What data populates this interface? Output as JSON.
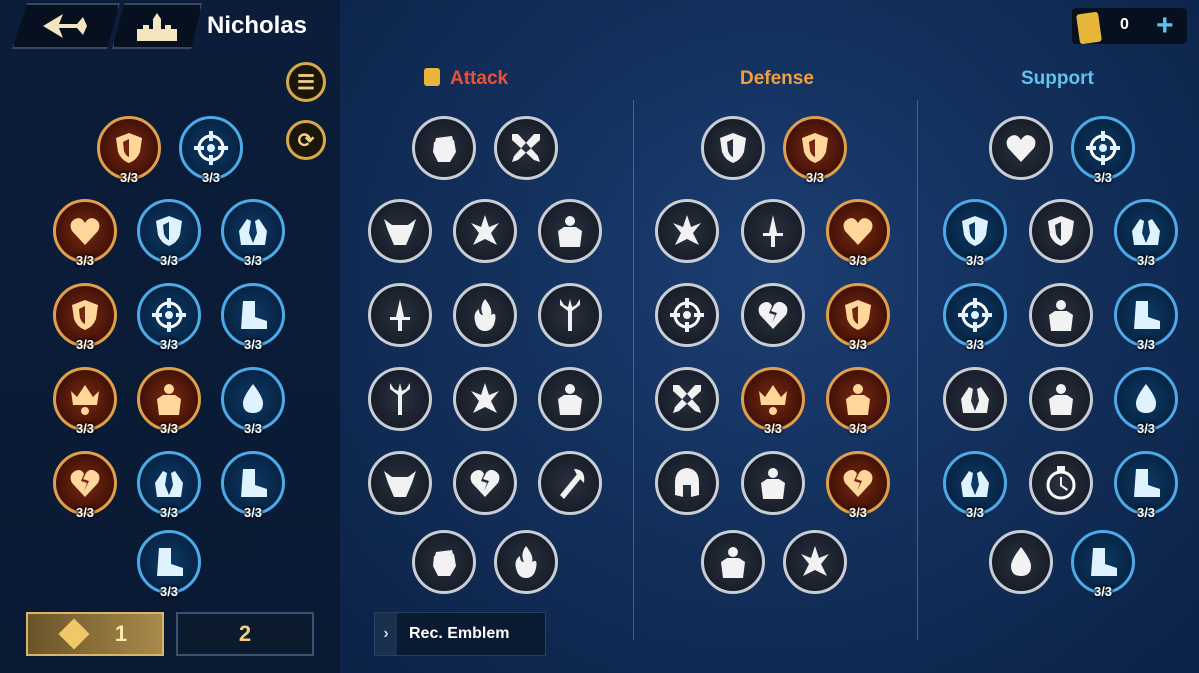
{
  "header": {
    "player_name": "Nicholas",
    "coin_value": "0"
  },
  "columns": {
    "attack": "Attack",
    "defense": "Defense",
    "support": "Support"
  },
  "colors": {
    "attack": "#e8523a",
    "defense": "#f0a040",
    "support": "#5fc3f0"
  },
  "counts": {
    "c": "3/3"
  },
  "tabs": {
    "tab1": "1",
    "tab2": "2"
  },
  "rec_emblem": "Rec. Emblem"
}
